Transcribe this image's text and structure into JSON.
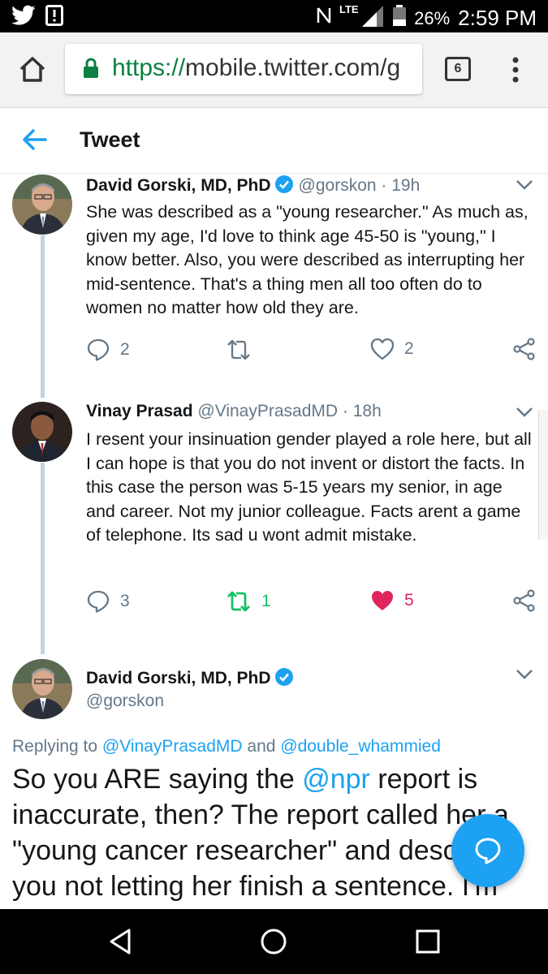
{
  "status_bar": {
    "battery": "26%",
    "time": "2:59 PM",
    "network": "LTE"
  },
  "browser": {
    "url_scheme": "https://",
    "url_host": "mobile.twitter.com/g",
    "tab_count": "6"
  },
  "header": {
    "title": "Tweet"
  },
  "tweets": [
    {
      "name": "David Gorski, MD, PhD",
      "handle": "@gorskon",
      "time": "· 19h",
      "verified": true,
      "text": "She was described as a \"young researcher.\" As much as, given my age, I'd love to think age 45-50 is \"young,\" I know better. Also, you were described as interrupting her mid-sentence. That's a thing men all too often do to women no matter how old they are.",
      "replies": "2",
      "retweets": "",
      "likes": "2"
    },
    {
      "name": "Vinay Prasad",
      "handle": "@VinayPrasadMD",
      "time": "· 18h",
      "verified": false,
      "text": "I resent your insinuation gender played a role here, but all I can hope is that you do not invent or distort the facts.  In this case the person was 5-15 years my senior, in age and career. Not my junior colleague. Facts arent a game of telephone. Its sad u wont admit mistake.",
      "replies": "3",
      "retweets": "1",
      "likes": "5"
    }
  ],
  "focused_tweet": {
    "name": "David Gorski, MD, PhD",
    "handle": "@gorskon",
    "replying_prefix": "Replying to ",
    "replying_user1": "@VinayPrasadMD",
    "replying_and": " and ",
    "replying_user2": "@double_whammied",
    "text_part1": "So you ARE saying the ",
    "text_mention": "@npr",
    "text_part2": " report is inaccurate, then? The report called her a \"young cancer researcher\" and described you not letting her finish a sentence. I'm"
  },
  "colors": {
    "accent": "#1da1f2",
    "retweet_active": "#17bf63",
    "like_active": "#e0245e",
    "secure_green": "#0b8043"
  }
}
